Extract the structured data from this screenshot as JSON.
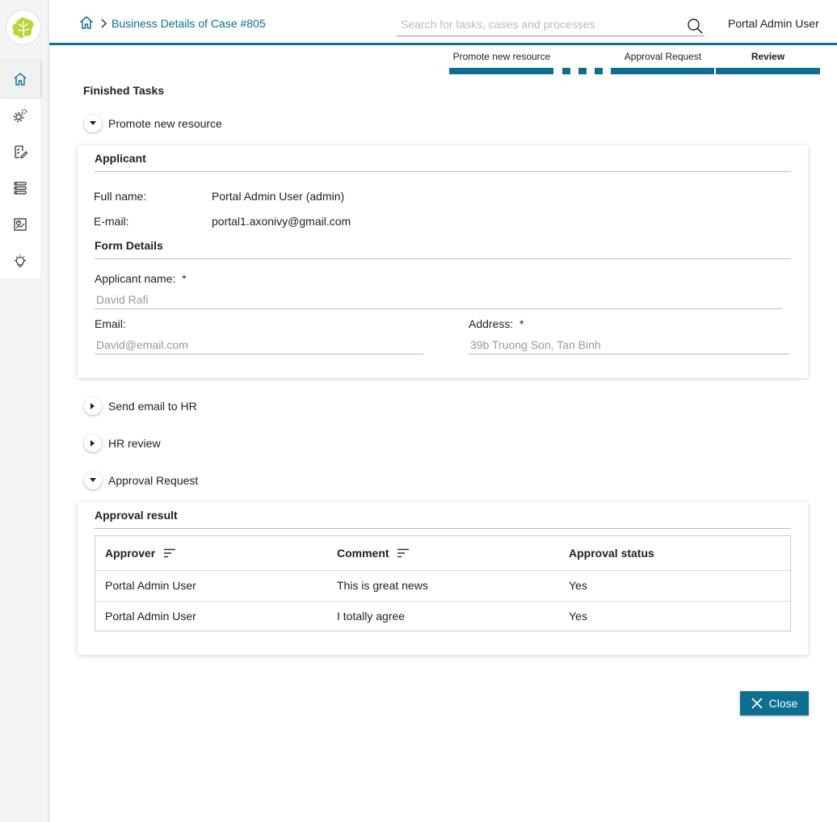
{
  "header": {
    "breadcrumb_title": "Business Details of Case #805",
    "search_placeholder": "Search for tasks, cases and processes",
    "user_name": "Portal Admin User"
  },
  "stepper": {
    "steps": [
      "Promote new resource",
      "Approval Request",
      "Review"
    ]
  },
  "main": {
    "section_title": "Finished Tasks",
    "tasks": [
      {
        "label": "Promote new resource",
        "expanded": true
      },
      {
        "label": "Send email to HR",
        "expanded": false
      },
      {
        "label": "HR review",
        "expanded": false
      },
      {
        "label": "Approval Request",
        "expanded": true
      }
    ],
    "applicant_card": {
      "applicant_title": "Applicant",
      "full_name_label": "Full name:",
      "full_name_value": "Portal Admin User (admin)",
      "email_label": "E-mail:",
      "email_value": "portal1.axonivy@gmail.com",
      "form_details_title": "Form Details",
      "applicant_name_label": "Applicant name:",
      "applicant_name_value": "David Rafi",
      "email_field_label": "Email:",
      "email_field_value": "David@email.com",
      "address_label": "Address:",
      "address_value": "39b Truong Son, Tan Binh",
      "required_mark": "*"
    },
    "approval_card": {
      "title": "Approval result",
      "columns": [
        "Approver",
        "Comment",
        "Approval status"
      ],
      "rows": [
        [
          "Portal Admin User",
          "This is great news",
          "Yes"
        ],
        [
          "Portal Admin User",
          "I totally agree",
          "Yes"
        ]
      ]
    },
    "close_label": "Close"
  },
  "colors": {
    "accent": "#0c6f91"
  }
}
